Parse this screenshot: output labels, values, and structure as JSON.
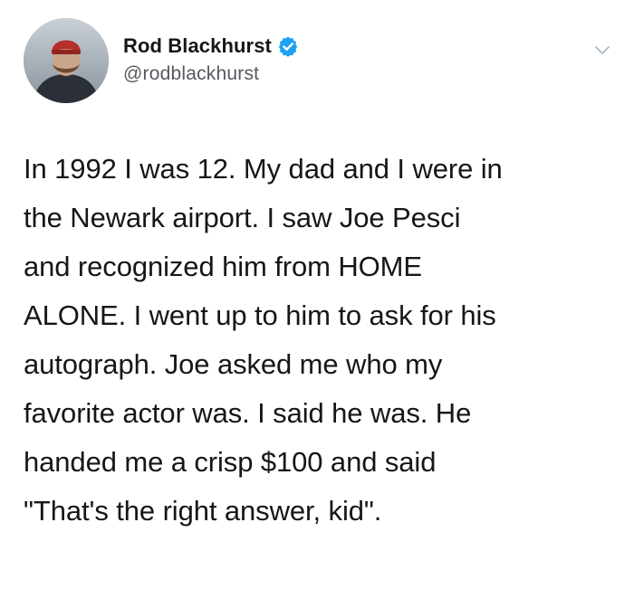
{
  "tweet": {
    "author": {
      "display_name": "Rod Blackhurst",
      "handle": "@rodblackhurst",
      "verified": true
    },
    "lines": [
      "In 1992 I was 12. My dad and I were in",
      "the Newark airport. I saw Joe Pesci",
      "and recognized him from HOME",
      "ALONE. I went up to him to ask for his",
      "autograph. Joe asked me who my",
      "favorite actor was. I said he was. He",
      "handed me a crisp $100 and said",
      "\"That's the right answer, kid\"."
    ]
  },
  "colors": {
    "text_primary": "#14171a",
    "text_secondary": "#55595f",
    "verified_blue": "#1da1f2",
    "chevron_gray": "#aab8c2"
  },
  "icons": {
    "verified": "verified-badge-icon",
    "menu": "chevron-down-icon"
  }
}
